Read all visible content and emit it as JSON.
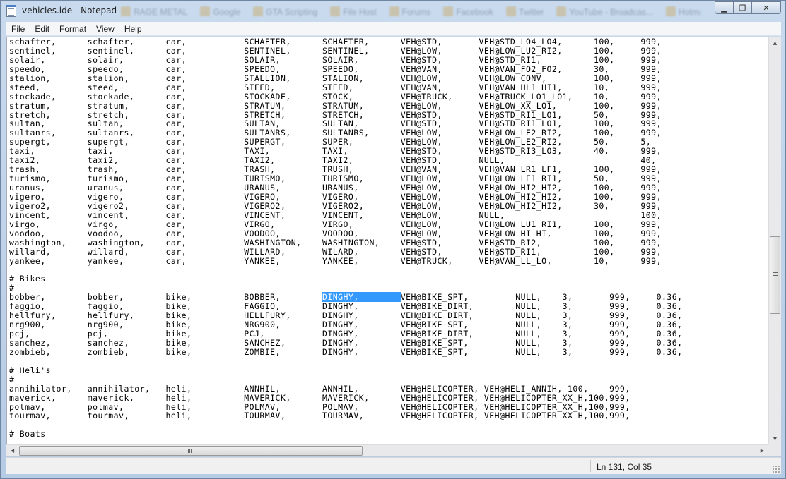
{
  "window": {
    "title": "vehicles.ide - Notepad",
    "background_tabs": [
      "RAGE METAL",
      "Google",
      "GTA Scripting",
      "File Host",
      "Forums",
      "Facebook",
      "Twitter",
      "YouTube - Broadcas...",
      "Hotmail"
    ]
  },
  "menu": {
    "file": "File",
    "edit": "Edit",
    "format": "Format",
    "view": "View",
    "help": "Help"
  },
  "editor": {
    "lines": [
      "schafter,      schafter,      car,           SCHAFTER,      SCHAFTER,      VEH@STD,       VEH@STD_LO4_LO4,      100,     999,",
      "sentinel,      sentinel,      car,           SENTINEL,      SENTINEL,      VEH@LOW,       VEH@LOW_LU2_RI2,      100,     999,",
      "solair,        solair,        car,           SOLAIR,        SOLAIR,        VEH@STD,       VEH@STD_RI1,          100,     999,",
      "speedo,        speedo,        car,           SPEEDO,        SPEEDO,        VEH@VAN,       VEH@VAN_FO2_FO2,      30,      999,",
      "stalion,       stalion,       car,           STALLION,      STALION,       VEH@LOW,       VEH@LOW_CONV,         100,     999,",
      "steed,         steed,         car,           STEED,         STEED,         VEH@VAN,       VEH@VAN_HL1_HI1,      10,      999,",
      "stockade,      stockade,      car,           STOCKADE,      STOCK,         VEH@TRUCK,     VEH@TRUCK_LO1_LO1,    10,      999,",
      "stratum,       stratum,       car,           STRATUM,       STRATUM,       VEH@LOW,       VEH@LOW_XX_LO1,       100,     999,",
      "stretch,       stretch,       car,           STRETCH,       STRETCH,       VEH@STD,       VEH@STD_RI1_LO1,      50,      999,",
      "sultan,        sultan,        car,           SULTAN,        SULTAN,        VEH@STD,       VEH@STD_RI1_LO1,      100,     999,",
      "sultanrs,      sultanrs,      car,           SULTANRS,      SULTANRS,      VEH@LOW,       VEH@LOW_LE2_RI2,      100,     999,",
      "supergt,       supergt,       car,           SUPERGT,       SUPER,         VEH@LOW,       VEH@LOW_LE2_RI2,      50,      5,",
      "taxi,          taxi,          car,           TAXI,          TAXI,          VEH@STD,       VEH@STD_RI3_LO3,      40,      999,",
      "taxi2,         taxi2,         car,           TAXI2,         TAXI2,         VEH@STD,       NULL,                          40,",
      "trash,         trash,         car,           TRASH,         TRUSH,         VEH@VAN,       VEH@VAN_LR1_LF1,      100,     999,",
      "turismo,       turismo,       car,           TURISMO,       TURISMO,       VEH@LOW,       VEH@LOW_LE1_RI1,      50,      999,",
      "uranus,        uranus,        car,           URANUS,        URANUS,        VEH@LOW,       VEH@LOW_HI2_HI2,      100,     999,",
      "vigero,        vigero,        car,           VIGERO,        VIGERO,        VEH@LOW,       VEH@LOW_HI2_HI2,      100,     999,",
      "vigero2,       vigero2,       car,           VIGERO2,       VIGERO2,       VEH@LOW,       VEH@LOW_HI2_HI2,      30,      999,",
      "vincent,       vincent,       car,           VINCENT,       VINCENT,       VEH@LOW,       NULL,                          100,",
      "virgo,         virgo,         car,           VIRGO,         VIRGO,         VEH@LOW,       VEH@LOW_LU1_RI1,      100,     999,",
      "voodoo,        voodoo,        car,           VOODOO,        VOODOO,        VEH@LOW,       VEH@LOW_HI_HI,        100,     999,",
      "washington,    washington,    car,           WASHINGTON,    WASHINGTON,    VEH@STD,       VEH@STD_RI2,          100,     999,",
      "willard,       willard,       car,           WILLARD,       WILARD,        VEH@STD,       VEH@STD_RI1,          100,     999,",
      "yankee,        yankee,        car,           YANKEE,        YANKEE,        VEH@TRUCK,     VEH@VAN_LL_LO,        10,      999,",
      "",
      "# Bikes",
      "#",
      "bobber,        bobber,        bike,          BOBBER,        DINGHY,        VEH@BIKE_SPT,         NULL,    3,       999,     0.36,",
      "faggio,        faggio,        bike,          FAGGIO,        DINGHY,        VEH@BIKE_DIRT,        NULL,    3,       999,     0.36,",
      "hellfury,      hellfury,      bike,          HELLFURY,      DINGHY,        VEH@BIKE_DIRT,        NULL,    3,       999,     0.36,",
      "nrg900,        nrg900,        bike,          NRG900,        DINGHY,        VEH@BIKE_SPT,         NULL,    3,       999,     0.36,",
      "pcj,           pcj,           bike,          PCJ,           DINGHY,        VEH@BIKE_DIRT,        NULL,    3,       999,     0.36,",
      "sanchez,       sanchez,       bike,          SANCHEZ,       DINGHY,        VEH@BIKE_SPT,         NULL,    3,       999,     0.36,",
      "zombieb,       zombieb,       bike,          ZOMBIE,        DINGHY,        VEH@BIKE_SPT,         NULL,    3,       999,     0.36,",
      "",
      "# Heli's",
      "#",
      "annihilator,   annihilator,   heli,          ANNHIL,        ANNHIL,        VEH@HELICOPTER, VEH@HELI_ANNIH, 100,    999,",
      "maverick,      maverick,      heli,          MAVERICK,      MAVERICK,      VEH@HELICOPTER, VEH@HELICOPTER_XX_H,100,999,",
      "polmav,        polmav,        heli,          POLMAV,        POLMAV,        VEH@HELICOPTER, VEH@HELICOPTER_XX_H,100,999,",
      "tourmav,       tourmav,       heli,          TOURMAV,       TOURMAV,       VEH@HELICOPTER, VEH@HELICOPTER_XX_H,100,999,",
      "",
      "# Boats"
    ],
    "selection": {
      "line_index": 28,
      "before": "bobber,        bobber,        bike,          BOBBER,        ",
      "selected": "DINGHY,        ",
      "after": "VEH@BIKE_SPT,         NULL,    3,       999,     0.36,"
    }
  },
  "status": {
    "position": "Ln 131, Col 35"
  },
  "colors": {
    "selection": "#3399ff",
    "titlebar": "#c9daee"
  }
}
